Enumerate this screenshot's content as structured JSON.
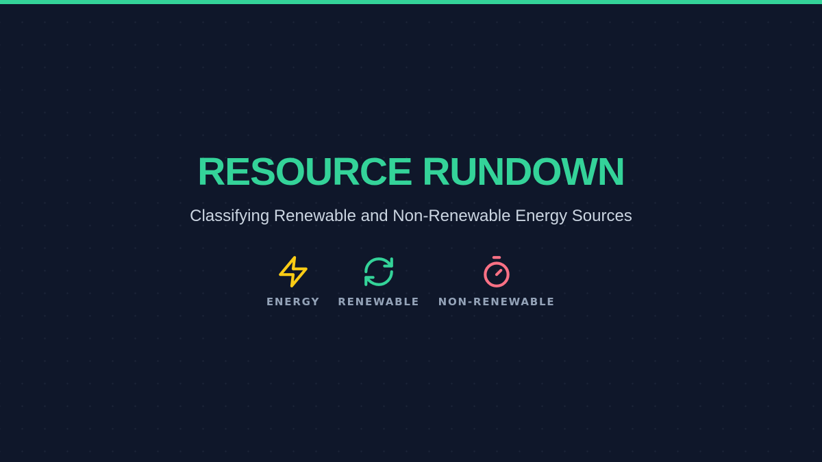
{
  "title": "RESOURCE RUNDOWN",
  "subtitle": "Classifying Renewable and Non-Renewable Energy Sources",
  "colors": {
    "background": "#0f172a",
    "accent_bar": "#34d399",
    "title": "#34d399",
    "subtitle": "#cbd5e1",
    "label": "#94a3b8"
  },
  "badges": [
    {
      "label": "ENERGY",
      "icon": "lightning-bolt-icon",
      "color": "#facc15"
    },
    {
      "label": "RENEWABLE",
      "icon": "refresh-cycle-icon",
      "color": "#34d399"
    },
    {
      "label": "NON-RENEWABLE",
      "icon": "timer-icon",
      "color": "#fb7185"
    }
  ]
}
